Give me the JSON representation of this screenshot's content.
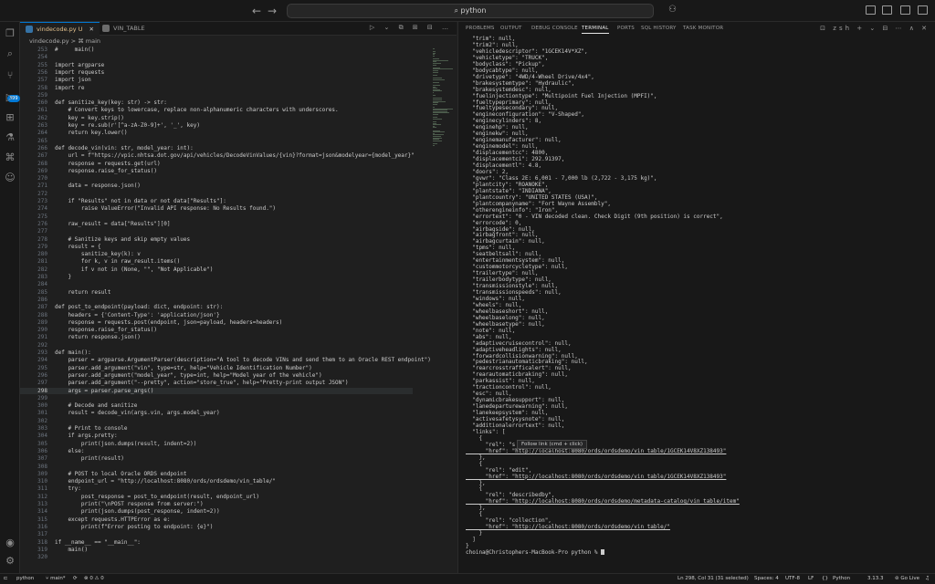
{
  "titlebar": {
    "back": "←",
    "forward": "→",
    "search_text": "python"
  },
  "activity": {
    "scm_badge": "399"
  },
  "tabs": [
    {
      "label": "vindecode.py",
      "status": "U"
    },
    {
      "label": "VIN_TABLE"
    }
  ],
  "breadcrumb": "vindecode.py > ⌘ main",
  "editor_actions": "▷ ⌄ ⧉ ⊞ ⊟ …",
  "code_lines": [
    {
      "n": "253",
      "t": "#     main()"
    },
    {
      "n": "254",
      "t": ""
    },
    {
      "n": "255",
      "t": "import argparse"
    },
    {
      "n": "256",
      "t": "import requests"
    },
    {
      "n": "257",
      "t": "import json"
    },
    {
      "n": "258",
      "t": "import re"
    },
    {
      "n": "259",
      "t": ""
    },
    {
      "n": "260",
      "t": "def sanitize_key(key: str) -> str:"
    },
    {
      "n": "261",
      "t": "    # Convert keys to lowercase, replace non-alphanumeric characters with underscores."
    },
    {
      "n": "262",
      "t": "    key = key.strip()"
    },
    {
      "n": "263",
      "t": "    key = re.sub(r'[^a-zA-Z0-9]+', '_', key)"
    },
    {
      "n": "264",
      "t": "    return key.lower()"
    },
    {
      "n": "265",
      "t": ""
    },
    {
      "n": "266",
      "t": "def decode_vin(vin: str, model_year: int):"
    },
    {
      "n": "267",
      "t": "    url = f\"https://vpic.nhtsa.dot.gov/api/vehicles/DecodeVinValues/{vin}?format=json&modelyear={model_year}\""
    },
    {
      "n": "268",
      "t": "    response = requests.get(url)"
    },
    {
      "n": "269",
      "t": "    response.raise_for_status()"
    },
    {
      "n": "270",
      "t": ""
    },
    {
      "n": "271",
      "t": "    data = response.json()"
    },
    {
      "n": "272",
      "t": ""
    },
    {
      "n": "273",
      "t": "    if \"Results\" not in data or not data[\"Results\"]:"
    },
    {
      "n": "274",
      "t": "        raise ValueError(\"Invalid API response: No Results found.\")"
    },
    {
      "n": "275",
      "t": ""
    },
    {
      "n": "276",
      "t": "    raw_result = data[\"Results\"][0]"
    },
    {
      "n": "277",
      "t": ""
    },
    {
      "n": "278",
      "t": "    # Sanitize keys and skip empty values"
    },
    {
      "n": "279",
      "t": "    result = {"
    },
    {
      "n": "280",
      "t": "        sanitize_key(k): v"
    },
    {
      "n": "281",
      "t": "        for k, v in raw_result.items()"
    },
    {
      "n": "282",
      "t": "        if v not in (None, \"\", \"Not Applicable\")"
    },
    {
      "n": "283",
      "t": "    }"
    },
    {
      "n": "284",
      "t": ""
    },
    {
      "n": "285",
      "t": "    return result"
    },
    {
      "n": "286",
      "t": ""
    },
    {
      "n": "287",
      "t": "def post_to_endpoint(payload: dict, endpoint: str):"
    },
    {
      "n": "288",
      "t": "    headers = {'Content-Type': 'application/json'}"
    },
    {
      "n": "289",
      "t": "    response = requests.post(endpoint, json=payload, headers=headers)"
    },
    {
      "n": "290",
      "t": "    response.raise_for_status()"
    },
    {
      "n": "291",
      "t": "    return response.json()"
    },
    {
      "n": "292",
      "t": ""
    },
    {
      "n": "293",
      "t": "def main():"
    },
    {
      "n": "294",
      "t": "    parser = argparse.ArgumentParser(description=\"A tool to decode VINs and send them to an Oracle REST endpoint\")"
    },
    {
      "n": "295",
      "t": "    parser.add_argument(\"vin\", type=str, help=\"Vehicle Identification Number\")"
    },
    {
      "n": "296",
      "t": "    parser.add_argument(\"model_year\", type=int, help=\"Model year of the vehicle\")"
    },
    {
      "n": "297",
      "t": "    parser.add_argument(\"--pretty\", action=\"store_true\", help=\"Pretty-print output JSON\")"
    },
    {
      "n": "298",
      "t": "    args = parser.parse_args()",
      "current": true
    },
    {
      "n": "299",
      "t": ""
    },
    {
      "n": "300",
      "t": "    # Decode and sanitize"
    },
    {
      "n": "301",
      "t": "    result = decode_vin(args.vin, args.model_year)"
    },
    {
      "n": "302",
      "t": ""
    },
    {
      "n": "303",
      "t": "    # Print to console"
    },
    {
      "n": "304",
      "t": "    if args.pretty:"
    },
    {
      "n": "305",
      "t": "        print(json.dumps(result, indent=2))"
    },
    {
      "n": "306",
      "t": "    else:"
    },
    {
      "n": "307",
      "t": "        print(result)"
    },
    {
      "n": "308",
      "t": ""
    },
    {
      "n": "309",
      "t": "    # POST to local Oracle ORDS endpoint"
    },
    {
      "n": "310",
      "t": "    endpoint_url = \"http://localhost:8080/ords/ordsdemo/vin_table/\""
    },
    {
      "n": "311",
      "t": "    try:"
    },
    {
      "n": "312",
      "t": "        post_response = post_to_endpoint(result, endpoint_url)"
    },
    {
      "n": "313",
      "t": "        print(\"\\nPOST response from server:\")"
    },
    {
      "n": "314",
      "t": "        print(json.dumps(post_response, indent=2))"
    },
    {
      "n": "315",
      "t": "    except requests.HTTPError as e:"
    },
    {
      "n": "316",
      "t": "        print(f\"Error posting to endpoint: {e}\")"
    },
    {
      "n": "317",
      "t": ""
    },
    {
      "n": "318",
      "t": "if __name__ == \"__main__\":"
    },
    {
      "n": "319",
      "t": "    main()"
    },
    {
      "n": "320",
      "t": ""
    }
  ],
  "panel": {
    "tabs": [
      "PROBLEMS",
      "OUTPUT",
      "DEBUG CONSOLE",
      "TERMINAL",
      "PORTS",
      "SQL HISTORY",
      "TASK MONITOR"
    ],
    "active_tab": "TERMINAL",
    "shell": "zsh",
    "actions": "+ ⌄ ⊟ ⋯ ∧ ✕"
  },
  "terminal_lines": [
    "  \"trim\": null,",
    "  \"trim2\": null,",
    "  \"vehicledescriptor\": \"1GCEK14V*XZ\",",
    "  \"vehicletype\": \"TRUCK\",",
    "  \"bodyclass\": \"Pickup\",",
    "  \"bodycabtype\": null,",
    "  \"drivetype\": \"4WD/4-Wheel Drive/4x4\",",
    "  \"brakesystemtype\": \"Hydraulic\",",
    "  \"brakesystemdesc\": null,",
    "  \"fuelinjectiontype\": \"Multipoint Fuel Injection (MPFI)\",",
    "  \"fueltypeprimary\": null,",
    "  \"fueltypesecondary\": null,",
    "  \"engineconfiguration\": \"V-Shaped\",",
    "  \"enginecylinders\": 8,",
    "  \"enginehp\": null,",
    "  \"enginekw\": null,",
    "  \"enginemanufacturer\": null,",
    "  \"enginemodel\": null,",
    "  \"displacementcc\": 4800,",
    "  \"displacementci\": 292.91397,",
    "  \"displacementl\": 4.8,",
    "  \"doors\": 2,",
    "  \"gvwr\": \"Class 2E: 6,001 - 7,000 lb (2,722 - 3,175 kg)\",",
    "  \"plantcity\": \"ROANOKE\",",
    "  \"plantstate\": \"INDIANA\",",
    "  \"plantcountry\": \"UNITED STATES (USA)\",",
    "  \"plantcompanyname\": \"Fort Wayne Assembly\",",
    "  \"otherengineinfo\": \"Iron\",",
    "  \"errortext\": \"0 - VIN decoded clean. Check Digit (9th position) is correct\",",
    "  \"errorcode\": 0,",
    "  \"airbagside\": null,",
    "  \"airbagfront\": null,",
    "  \"airbagcurtain\": null,",
    "  \"tpms\": null,",
    "  \"seatbeltsall\": null,",
    "  \"entertainmentsystem\": null,",
    "  \"custommotorcycletype\": null,",
    "  \"trailertype\": null,",
    "  \"trailerbodytype\": null,",
    "  \"transmissionstyle\": null,",
    "  \"transmissionspeeds\": null,",
    "  \"windows\": null,",
    "  \"wheels\": null,",
    "  \"wheelbaseshort\": null,",
    "  \"wheelbaselong\": null,",
    "  \"wheelbasetype\": null,",
    "  \"note\": null,",
    "  \"abs\": null,",
    "  \"adaptivecruisecontrol\": null,",
    "  \"adaptiveheadlights\": null,",
    "  \"forwardcollisionwarning\": null,",
    "  \"pedestrianautomaticbraking\": null,",
    "  \"rearcrosstrafficalert\": null,",
    "  \"rearautomaticbraking\": null,",
    "  \"parkassist\": null,",
    "  \"tractioncontrol\": null,",
    "  \"esc\": null,",
    "  \"dynamicbrakesupport\": null,",
    "  \"lanedeparturewarning\": null,",
    "  \"lanekeepsystem\": null,",
    "  \"activesafetysysnote\": null,",
    "  \"additionalerrortext\": null,",
    "  \"links\": [",
    "    {",
    "      \"rel\": \"s",
    "      \"href\": \"http://localhost:8080/ords/ordsdemo/vin_table/1GCEK14V8XZ138493\"",
    "    },",
    "    {",
    "      \"rel\": \"edit\",",
    "      \"href\": \"http://localhost:8080/ords/ordsdemo/vin_table/1GCEK14V8XZ138493\"",
    "    },",
    "    {",
    "      \"rel\": \"describedby\",",
    "      \"href\": \"http://localhost:8080/ords/ordsdemo/metadata-catalog/vin_table/item\"",
    "    },",
    "    {",
    "      \"rel\": \"collection\",",
    "      \"href\": \"http://localhost:8080/ords/ordsdemo/vin_table/\"",
    "    }",
    "  ]",
    "}",
    "choina@Christophers-MacBook-Pro python % "
  ],
  "tooltip": "Follow link (cmd + click)",
  "statusbar": {
    "branch": "main*",
    "sync": "⟳",
    "problems": "⊗ 0 ⚠ 0",
    "folder": "python",
    "position": "Ln 298, Col 31 (31 selected)",
    "spaces": "Spaces: 4",
    "encoding": "UTF-8",
    "eol": "LF",
    "language": "Python",
    "version": "3.13.3",
    "golive": "Go Live"
  }
}
